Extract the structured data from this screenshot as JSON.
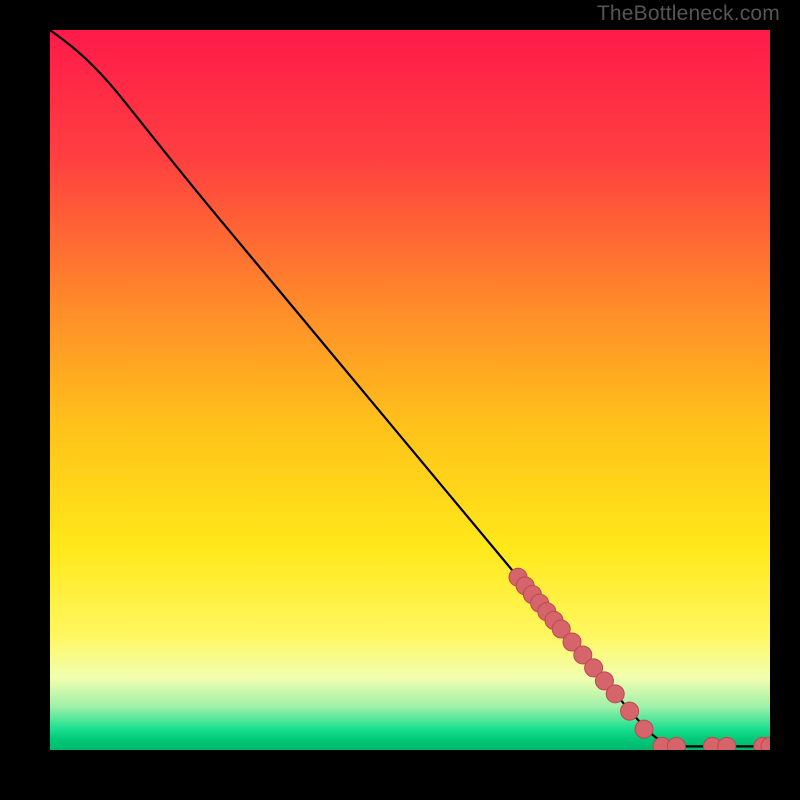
{
  "attribution": "TheBottleneck.com",
  "chart_data": {
    "type": "line",
    "title": "",
    "xlabel": "",
    "ylabel": "",
    "xlim": [
      0,
      100
    ],
    "ylim": [
      0,
      100
    ],
    "curve": [
      {
        "x": 0,
        "y": 100
      },
      {
        "x": 4,
        "y": 97
      },
      {
        "x": 8,
        "y": 93
      },
      {
        "x": 12,
        "y": 88
      },
      {
        "x": 20,
        "y": 78
      },
      {
        "x": 30,
        "y": 66
      },
      {
        "x": 40,
        "y": 54
      },
      {
        "x": 50,
        "y": 42
      },
      {
        "x": 60,
        "y": 30
      },
      {
        "x": 70,
        "y": 18
      },
      {
        "x": 80,
        "y": 6
      },
      {
        "x": 85,
        "y": 0.5
      },
      {
        "x": 90,
        "y": 0.5
      },
      {
        "x": 95,
        "y": 0.5
      },
      {
        "x": 100,
        "y": 0.5
      }
    ],
    "overlay_markers": [
      {
        "x": 65,
        "y": 24.0
      },
      {
        "x": 66,
        "y": 22.8
      },
      {
        "x": 67,
        "y": 21.6
      },
      {
        "x": 68,
        "y": 20.4
      },
      {
        "x": 69,
        "y": 19.2
      },
      {
        "x": 70,
        "y": 18.0
      },
      {
        "x": 71,
        "y": 16.8
      },
      {
        "x": 72.5,
        "y": 15.0
      },
      {
        "x": 74,
        "y": 13.2
      },
      {
        "x": 75.5,
        "y": 11.4
      },
      {
        "x": 77,
        "y": 9.6
      },
      {
        "x": 78.5,
        "y": 7.8
      },
      {
        "x": 80.5,
        "y": 5.4
      },
      {
        "x": 82.5,
        "y": 2.9
      },
      {
        "x": 85,
        "y": 0.5
      },
      {
        "x": 87,
        "y": 0.5
      },
      {
        "x": 92,
        "y": 0.5
      },
      {
        "x": 94,
        "y": 0.5
      },
      {
        "x": 99,
        "y": 0.5
      },
      {
        "x": 100,
        "y": 0.5
      }
    ],
    "gradient_stops": [
      {
        "offset": 0,
        "color": "#ff1a4a"
      },
      {
        "offset": 18,
        "color": "#ff4040"
      },
      {
        "offset": 38,
        "color": "#ff8a2a"
      },
      {
        "offset": 55,
        "color": "#ffc21a"
      },
      {
        "offset": 72,
        "color": "#ffe81a"
      },
      {
        "offset": 84,
        "color": "#fff760"
      },
      {
        "offset": 90,
        "color": "#f2ffb0"
      },
      {
        "offset": 94,
        "color": "#9ef0a8"
      },
      {
        "offset": 97,
        "color": "#1ee090"
      },
      {
        "offset": 98.5,
        "color": "#00c878"
      },
      {
        "offset": 100,
        "color": "#00b86b"
      }
    ],
    "marker_style": {
      "fill": "#d6646b",
      "stroke": "#b94a50",
      "r": 9
    },
    "line_style": {
      "stroke": "#000000",
      "width": 2.2
    }
  }
}
